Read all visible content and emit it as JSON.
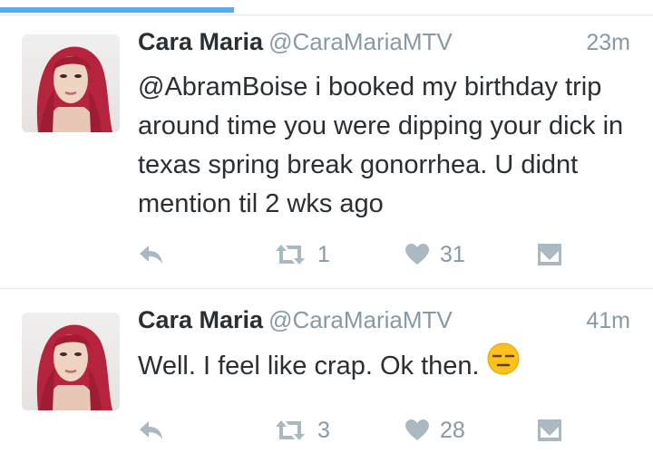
{
  "timeline": {
    "tweets": [
      {
        "display_name": "Cara Maria",
        "handle": "@CaraMariaMTV",
        "time": "23m",
        "text": "@AbramBoise i booked my birthday trip around time you were dipping your dick in texas spring break gonorrhea. U didnt mention til 2 wks ago",
        "retweets": "1",
        "likes": "31"
      },
      {
        "display_name": "Cara Maria",
        "handle": "@CaraMariaMTV",
        "time": "41m",
        "text": "Well. I feel like crap. Ok then.",
        "retweets": "3",
        "likes": "28"
      }
    ]
  },
  "icons": {
    "reply": "reply-icon",
    "retweet": "retweet-icon",
    "like": "heart-icon",
    "dm": "envelope-icon",
    "emoji": "expressionless-face-emoji"
  },
  "colors": {
    "accent": "#55acee",
    "text": "#292f33",
    "muted": "#8899a6",
    "icon": "#aab8c2",
    "divider": "#e1e8ed"
  }
}
